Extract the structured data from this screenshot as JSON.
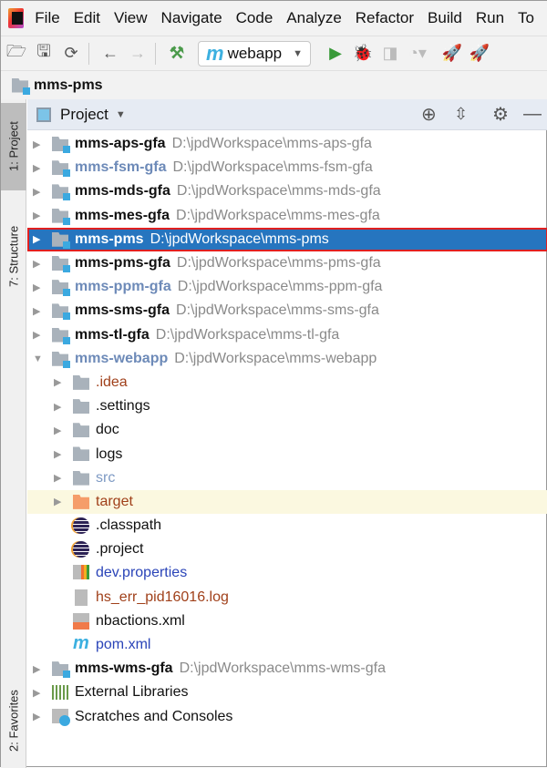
{
  "menu": [
    "File",
    "Edit",
    "View",
    "Navigate",
    "Code",
    "Analyze",
    "Refactor",
    "Build",
    "Run",
    "To"
  ],
  "toolbar": {
    "run_config": "webapp",
    "run_config_icon": "maven-m-icon",
    "accent_run": "#3a9a3a"
  },
  "breadcrumb": "mms-pms",
  "side_tabs": {
    "project": "1: Project",
    "structure": "7: Structure",
    "favorites": "2: Favorites"
  },
  "panel": {
    "title": "Project"
  },
  "colors": {
    "selection": "#2675bf",
    "selection_outline": "#e02020",
    "excluded": "#a0401a",
    "highlight_row": "#fbf8e0",
    "module_dim": "#6d8ab8",
    "path": "#8a8a8a"
  },
  "tree": [
    {
      "name": "mms-aps-gfa",
      "path": "D:\\jpdWorkspace\\mms-aps-gfa",
      "kind": "module",
      "style": "bold",
      "arrow": "right"
    },
    {
      "name": "mms-fsm-gfa",
      "path": "D:\\jpdWorkspace\\mms-fsm-gfa",
      "kind": "module",
      "style": "dim",
      "arrow": "right"
    },
    {
      "name": "mms-mds-gfa",
      "path": "D:\\jpdWorkspace\\mms-mds-gfa",
      "kind": "module",
      "style": "bold",
      "arrow": "right"
    },
    {
      "name": "mms-mes-gfa",
      "path": "D:\\jpdWorkspace\\mms-mes-gfa",
      "kind": "module",
      "style": "bold",
      "arrow": "right"
    },
    {
      "name": "mms-pms",
      "path": "D:\\jpdWorkspace\\mms-pms",
      "kind": "module",
      "style": "selected",
      "arrow": "right"
    },
    {
      "name": "mms-pms-gfa",
      "path": "D:\\jpdWorkspace\\mms-pms-gfa",
      "kind": "module",
      "style": "bold",
      "arrow": "right"
    },
    {
      "name": "mms-ppm-gfa",
      "path": "D:\\jpdWorkspace\\mms-ppm-gfa",
      "kind": "module",
      "style": "dim",
      "arrow": "right"
    },
    {
      "name": "mms-sms-gfa",
      "path": "D:\\jpdWorkspace\\mms-sms-gfa",
      "kind": "module",
      "style": "bold",
      "arrow": "right"
    },
    {
      "name": "mms-tl-gfa",
      "path": "D:\\jpdWorkspace\\mms-tl-gfa",
      "kind": "module",
      "style": "bold",
      "arrow": "right"
    },
    {
      "name": "mms-webapp",
      "path": "D:\\jpdWorkspace\\mms-webapp",
      "kind": "module",
      "style": "dim",
      "arrow": "down"
    },
    {
      "name": ".idea",
      "kind": "folder",
      "level": 1,
      "color": "#a0401a",
      "arrow": "right"
    },
    {
      "name": ".settings",
      "kind": "folder",
      "level": 1,
      "color": "#111",
      "arrow": "right"
    },
    {
      "name": "doc",
      "kind": "folder",
      "level": 1,
      "color": "#111",
      "arrow": "right"
    },
    {
      "name": "logs",
      "kind": "folder",
      "level": 1,
      "color": "#111",
      "arrow": "right"
    },
    {
      "name": "src",
      "kind": "folder",
      "level": 1,
      "color": "#7e9ac4",
      "arrow": "right"
    },
    {
      "name": "target",
      "kind": "folder-excluded",
      "level": 1,
      "color": "#a0401a",
      "arrow": "right",
      "highlight": true
    },
    {
      "name": ".classpath",
      "kind": "eclipse",
      "level": 1,
      "color": "#111"
    },
    {
      "name": ".project",
      "kind": "eclipse",
      "level": 1,
      "color": "#111"
    },
    {
      "name": "dev.properties",
      "kind": "properties",
      "level": 1,
      "color": "#2a44b8"
    },
    {
      "name": "hs_err_pid16016.log",
      "kind": "log",
      "level": 1,
      "color": "#a0401a"
    },
    {
      "name": "nbactions.xml",
      "kind": "xml",
      "level": 1,
      "color": "#111"
    },
    {
      "name": "pom.xml",
      "kind": "maven",
      "level": 1,
      "color": "#2a44b8"
    },
    {
      "name": "mms-wms-gfa",
      "path": "D:\\jpdWorkspace\\mms-wms-gfa",
      "kind": "module",
      "style": "bold",
      "arrow": "right"
    },
    {
      "name": "External Libraries",
      "kind": "libraries",
      "style": "plain",
      "arrow": "right"
    },
    {
      "name": "Scratches and Consoles",
      "kind": "scratches",
      "style": "plain",
      "arrow": "right"
    }
  ]
}
